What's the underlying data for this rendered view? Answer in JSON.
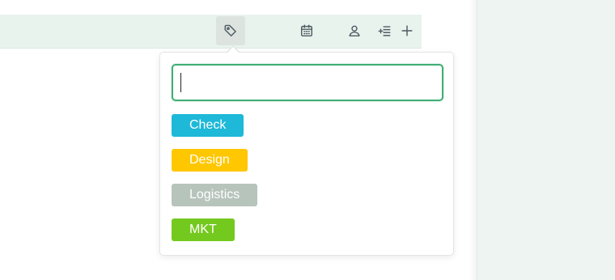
{
  "toolbar": {
    "buttons": [
      {
        "icon": "tag-icon",
        "active": true
      },
      {
        "icon": "calendar-icon",
        "active": false
      },
      {
        "icon": "person-icon",
        "active": false
      },
      {
        "icon": "add-list-icon",
        "active": false
      },
      {
        "icon": "plus-icon",
        "active": false
      }
    ]
  },
  "tag_picker": {
    "search_value": "",
    "tags": [
      {
        "label": "Check",
        "color": "#1eb8d8"
      },
      {
        "label": "Design",
        "color": "#ffc700"
      },
      {
        "label": "Logistics",
        "color": "#b7c4bc"
      },
      {
        "label": "MKT",
        "color": "#74c91e"
      }
    ]
  },
  "colors": {
    "toolbar_bg": "#e9f3ee",
    "right_pane_bg": "#eef4f1",
    "focus_accent": "#3fae74"
  }
}
